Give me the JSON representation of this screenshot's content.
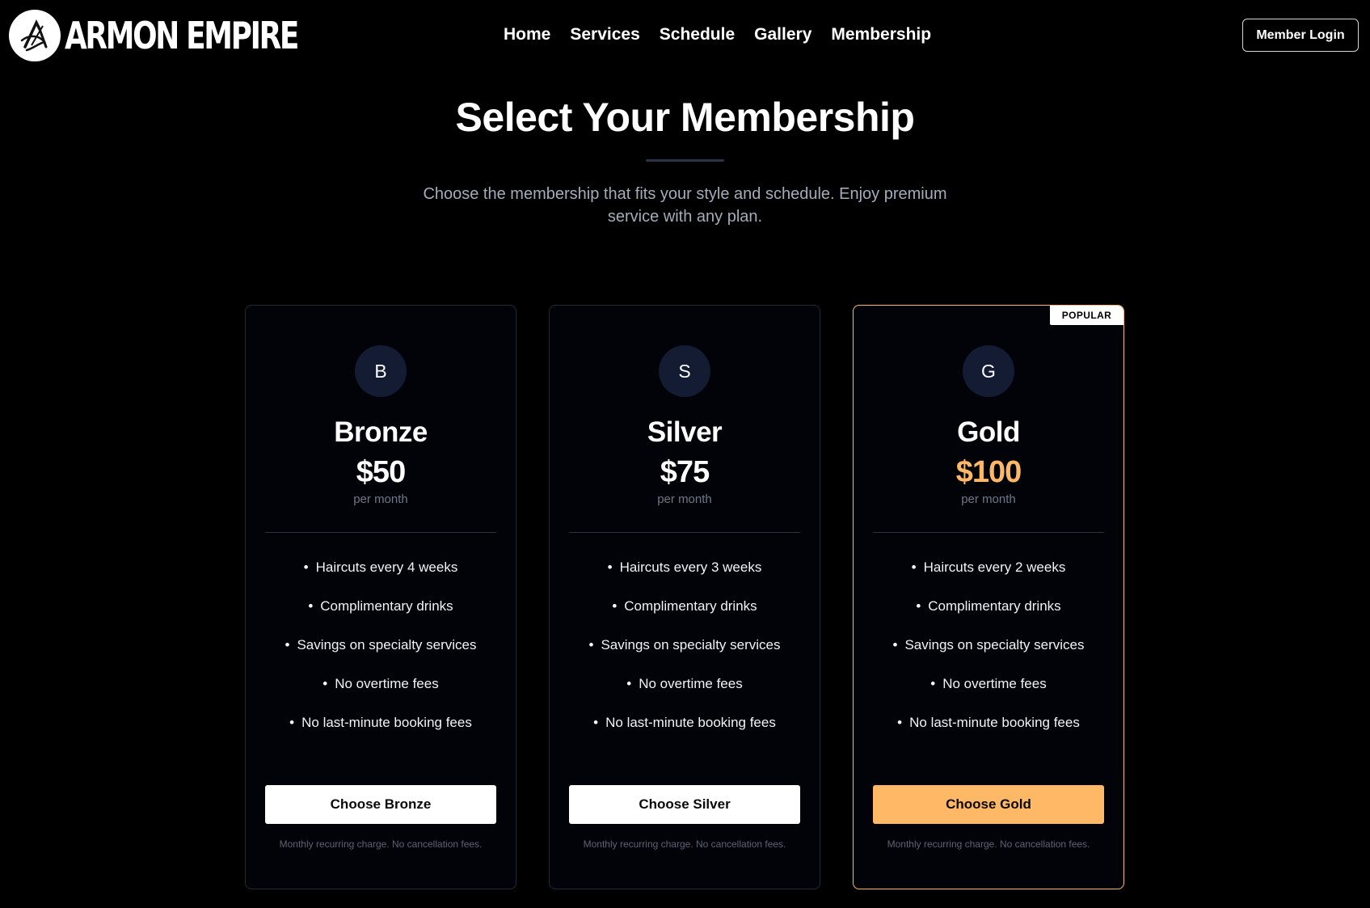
{
  "brand": {
    "name": "ARMON EMPIRE",
    "logo_icon": "armon-empire-logo-icon"
  },
  "nav": [
    {
      "label": "Home"
    },
    {
      "label": "Services"
    },
    {
      "label": "Schedule"
    },
    {
      "label": "Gallery"
    },
    {
      "label": "Membership"
    }
  ],
  "header": {
    "login_label": "Member Login"
  },
  "hero": {
    "title": "Select Your Membership",
    "subtitle": "Choose the membership that fits your style and schedule. Enjoy premium service with any plan."
  },
  "colors": {
    "accent": "#ffb866",
    "background": "#000000",
    "card_border": "#23283a",
    "initial_circle": "#131c33"
  },
  "plans": [
    {
      "initial": "B",
      "name": "Bronze",
      "price": "$50",
      "period": "per month",
      "features": [
        "Haircuts every 4 weeks",
        "Complimentary drinks",
        "Savings on specialty services",
        "No overtime fees",
        "No last-minute booking fees"
      ],
      "cta": "Choose Bronze",
      "note": "Monthly recurring charge. No cancellation fees.",
      "featured": false
    },
    {
      "initial": "S",
      "name": "Silver",
      "price": "$75",
      "period": "per month",
      "features": [
        "Haircuts every 3 weeks",
        "Complimentary drinks",
        "Savings on specialty services",
        "No overtime fees",
        "No last-minute booking fees"
      ],
      "cta": "Choose Silver",
      "note": "Monthly recurring charge. No cancellation fees.",
      "featured": false
    },
    {
      "initial": "G",
      "name": "Gold",
      "price": "$100",
      "period": "per month",
      "badge": "POPULAR",
      "features": [
        "Haircuts every 2 weeks",
        "Complimentary drinks",
        "Savings on specialty services",
        "No overtime fees",
        "No last-minute booking fees"
      ],
      "cta": "Choose Gold",
      "note": "Monthly recurring charge. No cancellation fees.",
      "featured": true
    }
  ]
}
